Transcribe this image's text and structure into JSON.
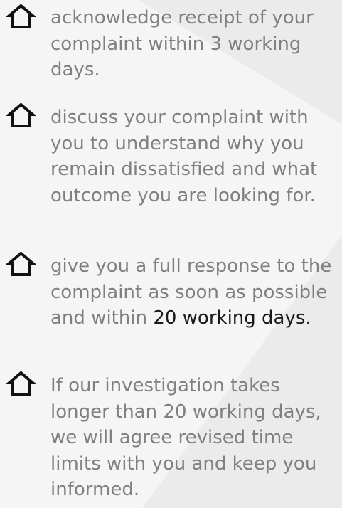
{
  "colors": {
    "background": "#ebebeb",
    "background_highlight": "#f5f5f5",
    "text": "#808080",
    "text_emphasis": "#1a1a1a",
    "icon": "#111111"
  },
  "list": {
    "icon": "house-outline-icon",
    "items": [
      {
        "text": "acknowledge receipt of your complaint within 3 working days."
      },
      {
        "text": "discuss your complaint with you to understand why you remain dissatisfied and what outcome you are looking for."
      },
      {
        "text": "give you a full response to the complaint as soon as possible and within ",
        "text_emphasis": "20 working days."
      },
      {
        "text": "If our investigation takes longer than 20 working days, we will agree revised time limits with you and keep you informed."
      }
    ]
  }
}
